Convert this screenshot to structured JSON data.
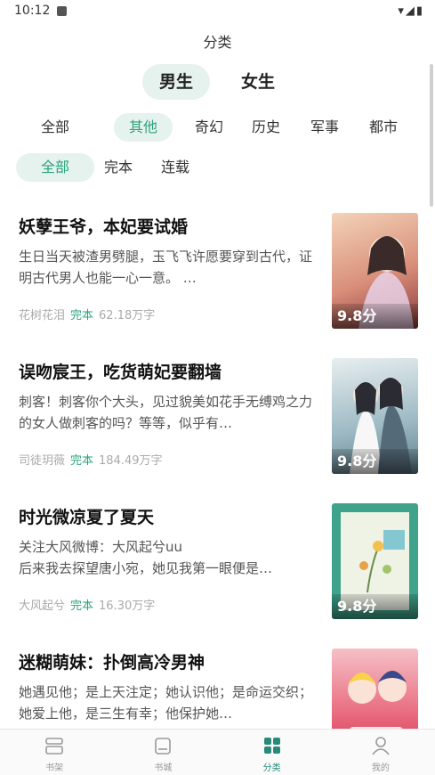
{
  "status_bar": {
    "time": "10:12",
    "icons": "▾◢▮"
  },
  "header": {
    "title": "分类"
  },
  "gender_tabs": [
    {
      "label": "男生",
      "active": true
    },
    {
      "label": "女生",
      "active": false
    }
  ],
  "category_filters": [
    {
      "label": "全部",
      "active": false
    },
    {
      "label": "其他",
      "active": true
    },
    {
      "label": "奇幻",
      "active": false
    },
    {
      "label": "历史",
      "active": false
    },
    {
      "label": "军事",
      "active": false
    },
    {
      "label": "都市",
      "active": false
    }
  ],
  "status_filters": [
    {
      "label": "全部",
      "active": true
    },
    {
      "label": "完本",
      "active": false
    },
    {
      "label": "连载",
      "active": false
    }
  ],
  "books": [
    {
      "title": "妖孽王爷，本妃要试婚",
      "description": "生日当天被渣男劈腿，玉飞飞许愿要穿到古代，证明古代男人也能一心一意。 …",
      "author": "花树花泪",
      "status": "完本",
      "word_count": "62.18万字",
      "score": "9.8分",
      "cover_color": "#d98f7a"
    },
    {
      "title": "误吻宸王，吃货萌妃要翻墙",
      "description": "刺客！刺客你个大头，见过貌美如花手无缚鸡之力的女人做刺客的吗？等等，似乎有…",
      "author": "司徒玥薇",
      "status": "完本",
      "word_count": "184.49万字",
      "score": "9.8分",
      "cover_color": "#9bb8c2"
    },
    {
      "title": "时光微凉夏了夏天",
      "description": "关注大风微博：大风起兮uu\n后来我去探望唐小宛，她见我第一眼便是…",
      "author": "大风起兮",
      "status": "完本",
      "word_count": "16.30万字",
      "score": "9.8分",
      "cover_color": "#3fa38c"
    },
    {
      "title": "迷糊萌妹：扑倒高冷男神",
      "description": "她遇见他；是上天注定；她认识他；是命运交织；她爱上他，是三生有幸；他保护她…",
      "author": "",
      "status": "",
      "word_count": "",
      "score": "",
      "cover_color": "#e8667a"
    }
  ],
  "tab_bar": [
    {
      "label": "书架",
      "icon": "bookshelf-icon",
      "active": false
    },
    {
      "label": "书城",
      "icon": "bookstore-icon",
      "active": false
    },
    {
      "label": "分类",
      "icon": "category-grid-icon",
      "active": true
    },
    {
      "label": "我的",
      "icon": "profile-icon",
      "active": false
    }
  ],
  "colors": {
    "accent": "#2aa37f",
    "chip_bg": "#e6f2ee",
    "tab_active": "#2a8a7a"
  }
}
